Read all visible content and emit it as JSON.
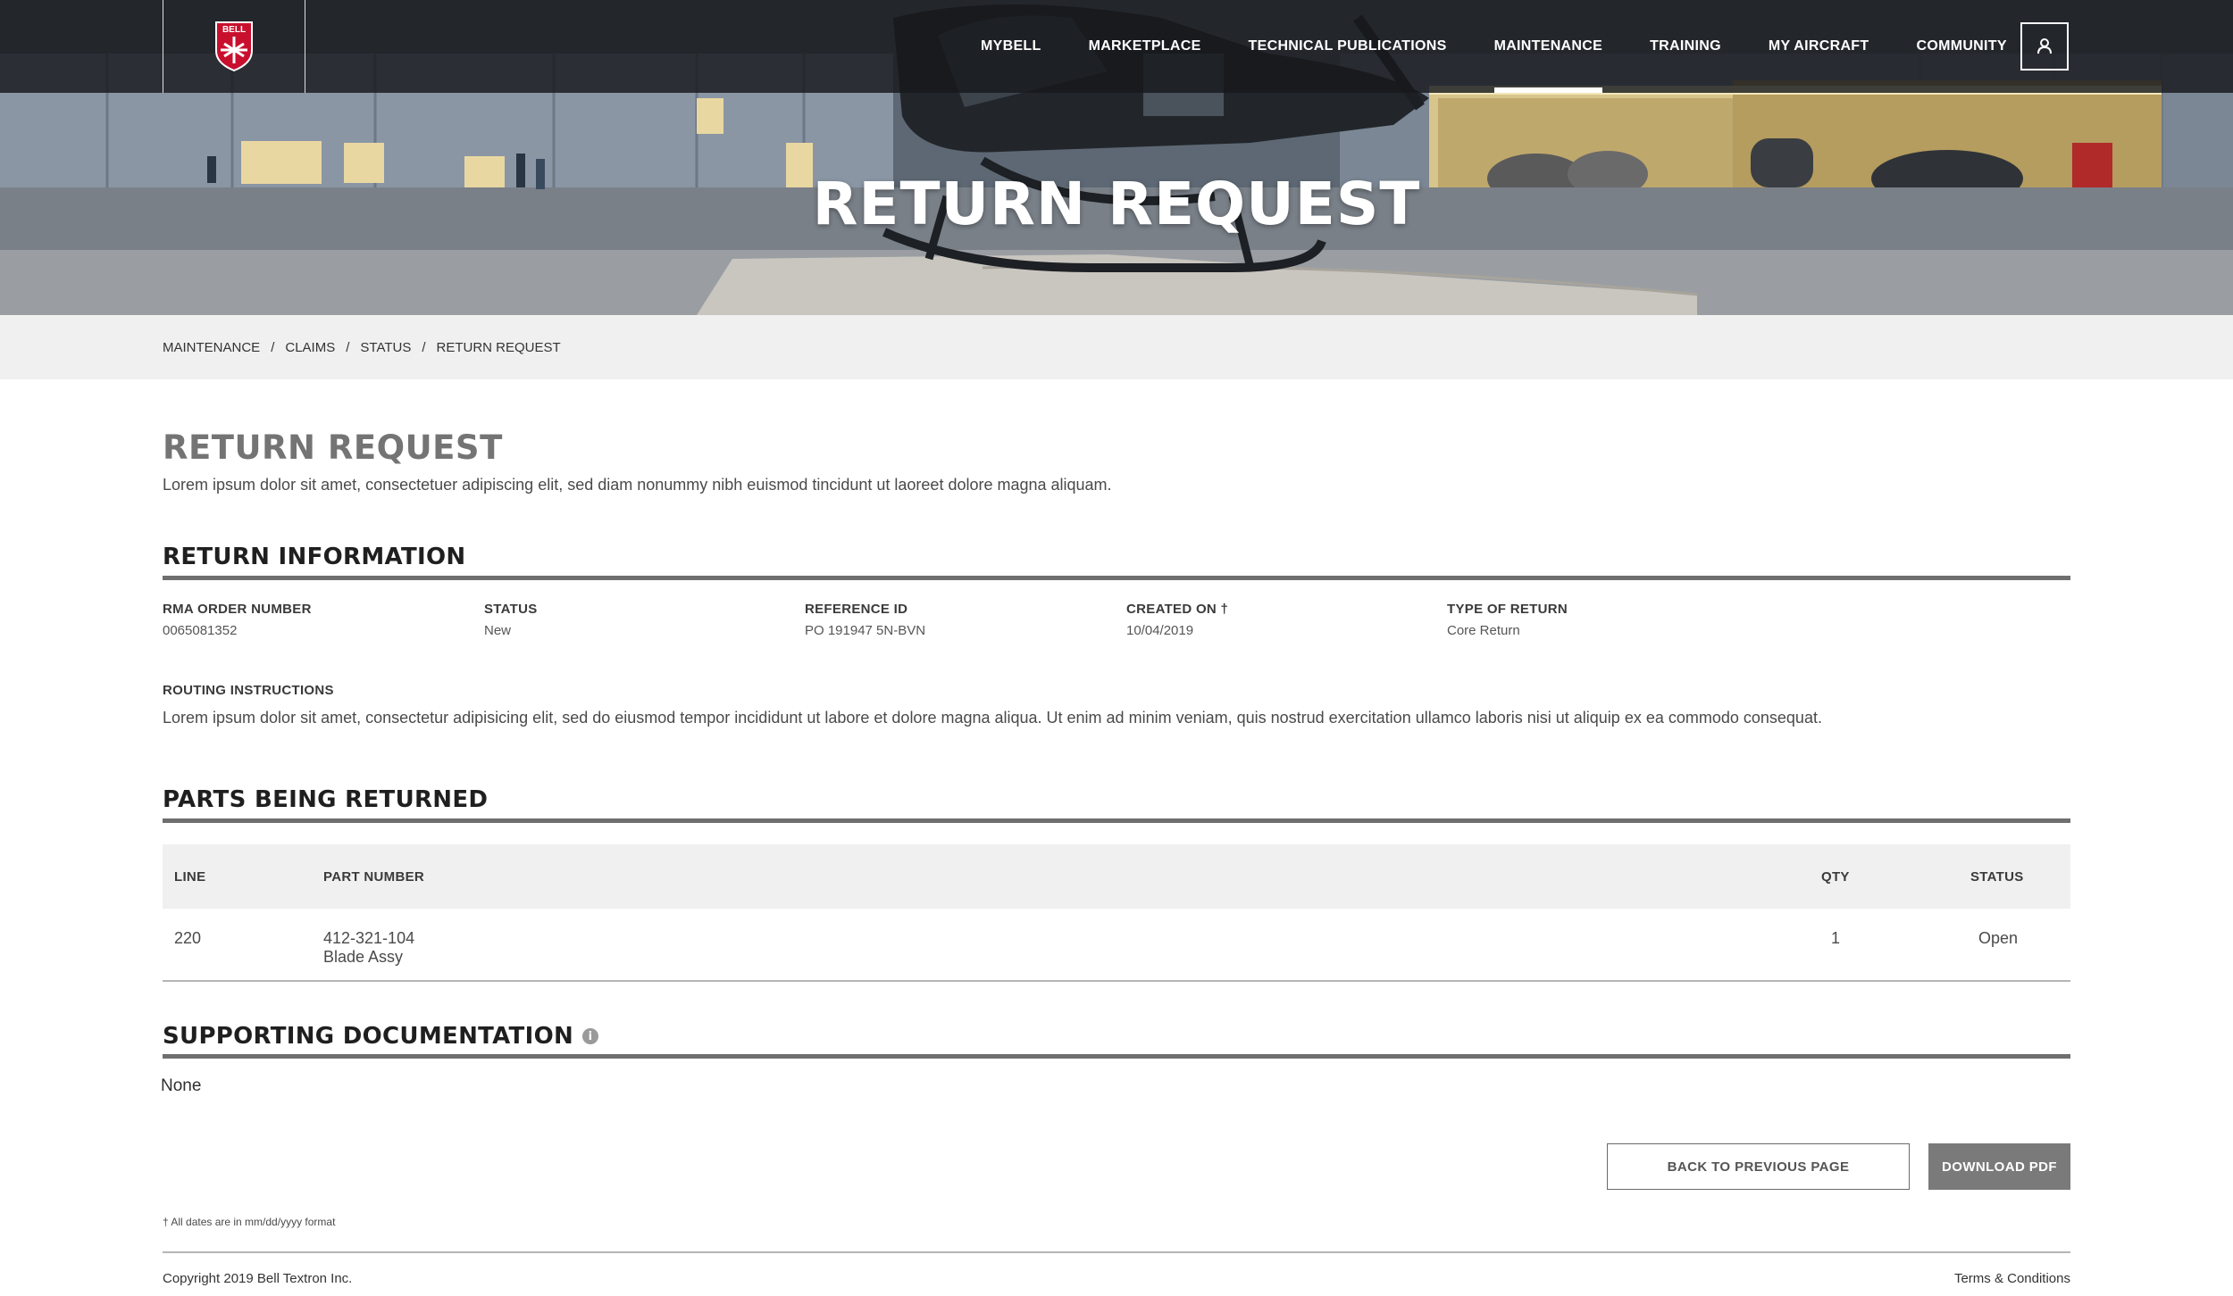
{
  "brand": {
    "logo_text": "BELL"
  },
  "nav": {
    "items": [
      {
        "label": "MYBELL"
      },
      {
        "label": "MARKETPLACE"
      },
      {
        "label": "TECHNICAL PUBLICATIONS"
      },
      {
        "label": "MAINTENANCE",
        "active": true
      },
      {
        "label": "TRAINING"
      },
      {
        "label": "MY AIRCRAFT"
      },
      {
        "label": "COMMUNITY"
      }
    ],
    "user_icon": "user-icon"
  },
  "hero": {
    "title": "RETURN REQUEST"
  },
  "breadcrumb": [
    "MAINTENANCE",
    "CLAIMS",
    "STATUS",
    "RETURN REQUEST"
  ],
  "page": {
    "title": "RETURN REQUEST",
    "intro": "Lorem ipsum dolor sit amet, consectetuer adipiscing elit, sed diam nonummy nibh euismod tincidunt ut laoreet dolore magna aliquam."
  },
  "return_info": {
    "heading": "RETURN INFORMATION",
    "fields": [
      {
        "label": "RMA ORDER NUMBER",
        "value": "0065081352"
      },
      {
        "label": "STATUS",
        "value": "New"
      },
      {
        "label": "REFERENCE ID",
        "value": "PO 191947 5N-BVN"
      },
      {
        "label": "CREATED ON †",
        "value": "10/04/2019"
      },
      {
        "label": "TYPE OF RETURN",
        "value": "Core Return"
      }
    ],
    "routing_label": "ROUTING INSTRUCTIONS",
    "routing_text": "Lorem ipsum dolor sit amet, consectetur adipisicing elit, sed do eiusmod tempor incididunt ut labore et dolore magna aliqua. Ut enim ad minim veniam, quis nostrud exercitation ullamco laboris nisi ut aliquip ex ea commodo consequat."
  },
  "parts": {
    "heading": "PARTS BEING RETURNED",
    "columns": {
      "line": "LINE",
      "part_number": "PART NUMBER",
      "qty": "QTY",
      "status": "STATUS"
    },
    "rows": [
      {
        "line": "220",
        "part_number": "412-321-104",
        "description": "Blade Assy",
        "qty": "1",
        "status": "Open"
      }
    ]
  },
  "documentation": {
    "heading": "SUPPORTING DOCUMENTATION",
    "info_icon": "info-icon",
    "value": "None"
  },
  "actions": {
    "back_label": "BACK TO PREVIOUS PAGE",
    "download_label": "DOWNLOAD PDF"
  },
  "footnote": "† All dates are in mm/dd/yyyy format",
  "footer": {
    "copyright": "Copyright 2019 Bell Textron Inc.",
    "terms": "Terms & Conditions"
  },
  "colors": {
    "accent_gray": "#747474",
    "rule_gray": "#6f6f6f",
    "nav_bg": "#16181c",
    "crumb_bg": "#f0f0f0",
    "logo_red": "#c8102e"
  }
}
